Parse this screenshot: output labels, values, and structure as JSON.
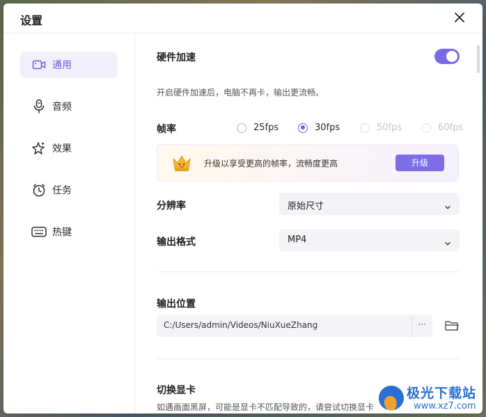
{
  "dialog": {
    "title": "设置"
  },
  "sidebar": {
    "items": [
      {
        "label": "通用",
        "icon": "video-camera-icon",
        "active": true
      },
      {
        "label": "音频",
        "icon": "microphone-icon",
        "active": false
      },
      {
        "label": "效果",
        "icon": "sparkle-icon",
        "active": false
      },
      {
        "label": "任务",
        "icon": "alarm-clock-icon",
        "active": false
      },
      {
        "label": "热键",
        "icon": "keyboard-icon",
        "active": false
      }
    ]
  },
  "general": {
    "hw_accel": {
      "label": "硬件加速",
      "enabled": true,
      "desc": "开启硬件加速后，电脑不再卡，输出更流畅。"
    },
    "framerate": {
      "label": "帧率",
      "options": [
        {
          "label": "25fps",
          "selected": false,
          "disabled": false
        },
        {
          "label": "30fps",
          "selected": true,
          "disabled": false
        },
        {
          "label": "50fps",
          "selected": false,
          "disabled": true
        },
        {
          "label": "60fps",
          "selected": false,
          "disabled": true
        }
      ]
    },
    "upgrade_banner": {
      "text": "升级以享受更高的帧率，流畅度更高",
      "button": "升级",
      "icon": "crown-icon"
    },
    "resolution": {
      "label": "分辨率",
      "value": "原始尺寸"
    },
    "output_format": {
      "label": "输出格式",
      "value": "MP4"
    },
    "output_location": {
      "label": "输出位置",
      "path": "C:/Users/admin/Videos/NiuXueZhang",
      "more": "···"
    },
    "gpu_switch": {
      "label": "切换显卡",
      "desc": "如遇画面黑屏，可能是显卡不匹配导致的，请尝试切换显卡"
    }
  },
  "watermark": {
    "name": "极光下载站",
    "url": "www.xz7.com"
  },
  "colors": {
    "accent": "#7a6ae6",
    "active_nav_bg": "#f1f0fb",
    "field_bg": "#f3f3f8"
  }
}
